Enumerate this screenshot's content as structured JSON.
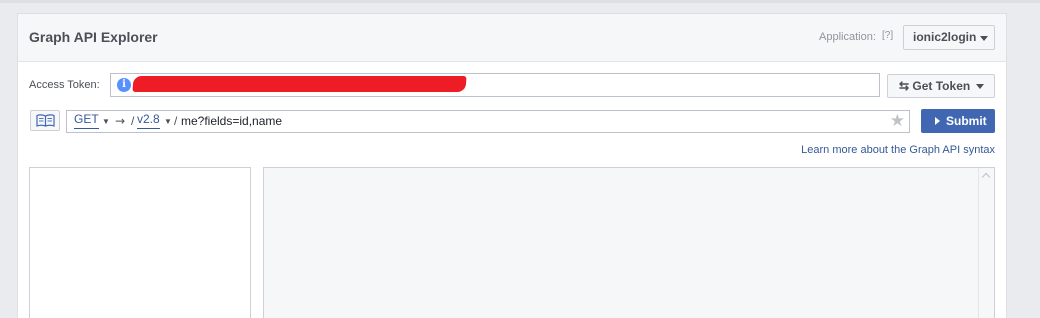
{
  "header": {
    "title": "Graph API Explorer",
    "application_label": "Application:",
    "application_help": "[?]",
    "application_selected": "ionic2login"
  },
  "access_token": {
    "label": "Access Token:",
    "value_redacted": true,
    "redaction_color": "#ee1c24",
    "get_token_label": "Get Token",
    "get_token_icon": "swap-arrows-icon"
  },
  "query": {
    "method": "GET",
    "arrow": "→",
    "slash": "/",
    "version": "v2.8",
    "path_prefix": "/",
    "path": "me?fields=id,name",
    "submit_label": "Submit",
    "favorite_icon": "star-icon",
    "docs_icon": "book-icon"
  },
  "learn_more_link": "Learn more about the Graph API syntax",
  "colors": {
    "primary": "#4267b2",
    "link": "#365899",
    "background": "#e9ebee"
  }
}
